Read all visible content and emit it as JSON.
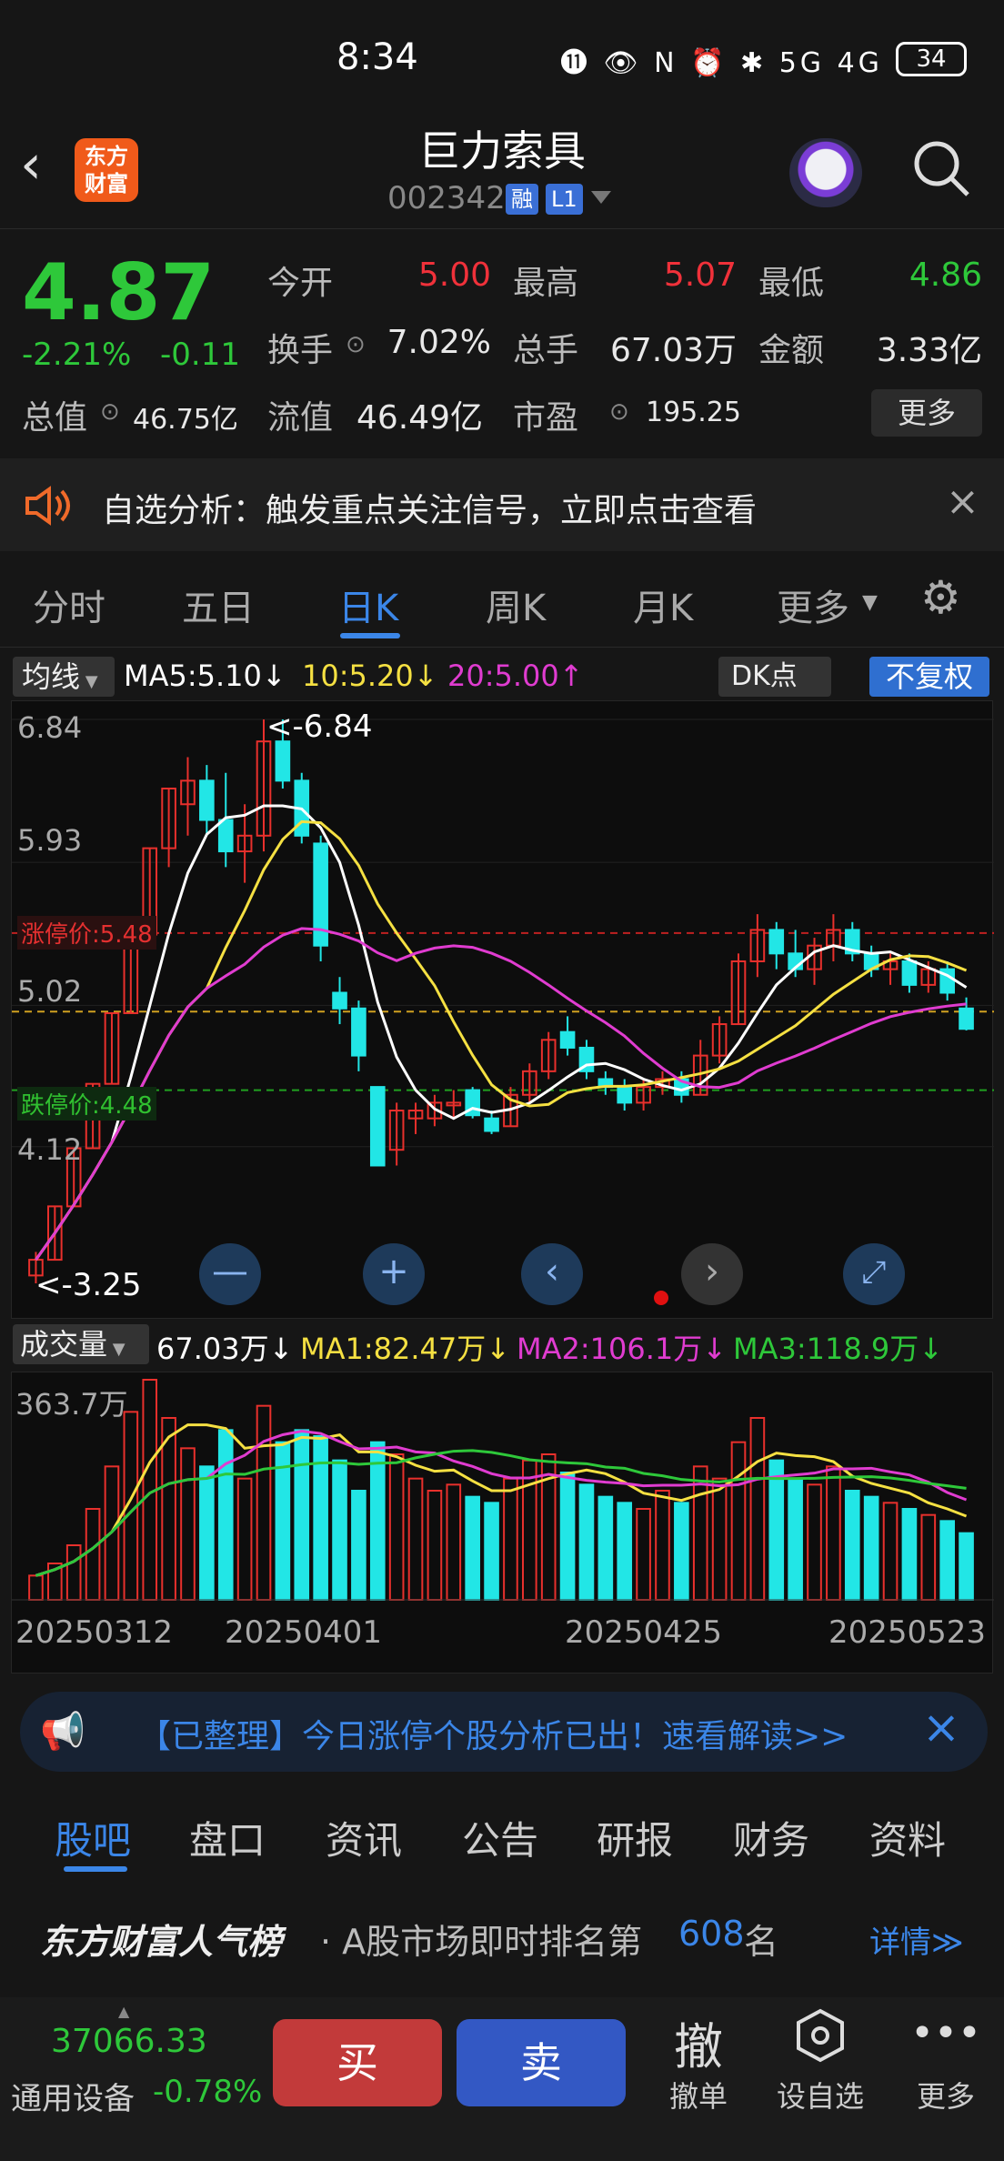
{
  "status": {
    "time": "8:34",
    "battery": "34",
    "icons": "⓫ 👁 N ⏰ ✱ 5G 4G"
  },
  "header": {
    "title": "巨力索具",
    "code": "002342",
    "tags": [
      "融",
      "L1"
    ],
    "logo": "东方\n财富"
  },
  "quote": {
    "price": "4.87",
    "change_pct": "-2.21%",
    "change_amt": "-0.11",
    "rows": [
      [
        {
          "l": "今开",
          "v": "5.00",
          "c": "up"
        },
        {
          "l": "最高",
          "v": "5.07",
          "c": "up"
        },
        {
          "l": "最低",
          "v": "4.86",
          "c": "down"
        }
      ],
      [
        {
          "l": "换手",
          "v": "7.02%",
          "c": ""
        },
        {
          "l": "总手",
          "v": "67.03万",
          "c": ""
        },
        {
          "l": "金额",
          "v": "3.33亿",
          "c": ""
        }
      ],
      [
        {
          "l": "总值",
          "v": "46.75亿",
          "c": ""
        },
        {
          "l": "流值",
          "v": "46.49亿",
          "c": ""
        },
        {
          "l": "市盈",
          "v": "195.25",
          "c": ""
        }
      ]
    ],
    "more": "更多"
  },
  "alert": {
    "text": "自选分析：触发重点关注信号，立即点击查看"
  },
  "tabs": [
    "分时",
    "五日",
    "日K",
    "周K",
    "月K",
    "更多"
  ],
  "active_tab": 2,
  "chart_labels": {
    "ma_selector": "均线",
    "ma5": "MA5:5.10↓",
    "ma10": "10:5.20↓",
    "ma20": "20:5.00↑",
    "dk": "DK点",
    "fq": "不复权",
    "y_top": "6.84",
    "y_2": "5.93",
    "y_3": "5.02",
    "y_4": "4.12",
    "y_bottom": "3.25",
    "high_mark": "<-6.84",
    "low_mark": "<-3.25",
    "limit_up": "涨停价:5.48",
    "limit_down": "跌停价:4.48",
    "vol_selector": "成交量",
    "vol_now": "67.03万↓",
    "vma1": "MA1:82.47万↓",
    "vma2": "MA2:106.1万↓",
    "vma3": "MA3:118.9万↓",
    "vol_top": "363.7万",
    "dates": [
      "20250312",
      "20250401",
      "20250425",
      "20250523"
    ]
  },
  "chart_data": {
    "type": "candlestick",
    "ylim": [
      3.25,
      6.84
    ],
    "candles": [
      [
        3.3,
        3.45,
        3.25,
        3.4
      ],
      [
        3.4,
        3.74,
        3.4,
        3.74
      ],
      [
        3.74,
        4.11,
        3.74,
        4.11
      ],
      [
        4.11,
        4.52,
        4.11,
        4.52
      ],
      [
        4.52,
        4.97,
        4.52,
        4.97
      ],
      [
        4.97,
        5.47,
        4.97,
        5.47
      ],
      [
        5.47,
        6.02,
        5.4,
        6.02
      ],
      [
        6.02,
        6.4,
        5.9,
        6.4
      ],
      [
        6.3,
        6.6,
        6.1,
        6.45
      ],
      [
        6.45,
        6.55,
        6.1,
        6.2
      ],
      [
        6.2,
        6.5,
        5.9,
        6.0
      ],
      [
        6.0,
        6.3,
        5.8,
        6.1
      ],
      [
        6.1,
        6.84,
        6.0,
        6.7
      ],
      [
        6.7,
        6.84,
        6.4,
        6.45
      ],
      [
        6.45,
        6.5,
        6.05,
        6.1
      ],
      [
        6.05,
        6.1,
        5.3,
        5.4
      ],
      [
        5.1,
        5.2,
        4.9,
        5.0
      ],
      [
        5.0,
        5.05,
        4.6,
        4.7
      ],
      [
        4.5,
        4.5,
        4.0,
        4.0
      ],
      [
        4.1,
        4.4,
        4.0,
        4.35
      ],
      [
        4.3,
        4.4,
        4.2,
        4.35
      ],
      [
        4.3,
        4.45,
        4.25,
        4.4
      ],
      [
        4.4,
        4.48,
        4.3,
        4.4
      ],
      [
        4.48,
        4.5,
        4.3,
        4.32
      ],
      [
        4.3,
        4.35,
        4.2,
        4.22
      ],
      [
        4.25,
        4.5,
        4.25,
        4.45
      ],
      [
        4.45,
        4.65,
        4.4,
        4.6
      ],
      [
        4.6,
        4.85,
        4.55,
        4.8
      ],
      [
        4.85,
        4.95,
        4.7,
        4.75
      ],
      [
        4.75,
        4.8,
        4.55,
        4.6
      ],
      [
        4.55,
        4.6,
        4.45,
        4.5
      ],
      [
        4.5,
        4.55,
        4.35,
        4.4
      ],
      [
        4.4,
        4.55,
        4.35,
        4.5
      ],
      [
        4.5,
        4.6,
        4.45,
        4.55
      ],
      [
        4.55,
        4.6,
        4.4,
        4.45
      ],
      [
        4.45,
        4.8,
        4.45,
        4.7
      ],
      [
        4.7,
        4.95,
        4.65,
        4.9
      ],
      [
        4.9,
        5.35,
        4.9,
        5.3
      ],
      [
        5.3,
        5.6,
        5.2,
        5.5
      ],
      [
        5.5,
        5.55,
        5.25,
        5.35
      ],
      [
        5.35,
        5.5,
        5.2,
        5.25
      ],
      [
        5.25,
        5.45,
        5.15,
        5.4
      ],
      [
        5.4,
        5.6,
        5.3,
        5.5
      ],
      [
        5.5,
        5.55,
        5.3,
        5.35
      ],
      [
        5.35,
        5.4,
        5.2,
        5.25
      ],
      [
        5.25,
        5.35,
        5.15,
        5.3
      ],
      [
        5.3,
        5.35,
        5.1,
        5.15
      ],
      [
        5.15,
        5.3,
        5.1,
        5.25
      ],
      [
        5.25,
        5.3,
        5.05,
        5.1
      ],
      [
        5.0,
        5.07,
        4.86,
        4.87
      ]
    ],
    "volume": [
      40,
      60,
      90,
      150,
      220,
      310,
      363,
      300,
      250,
      220,
      280,
      200,
      320,
      260,
      280,
      270,
      230,
      180,
      260,
      240,
      200,
      180,
      190,
      170,
      160,
      200,
      230,
      240,
      210,
      190,
      170,
      160,
      150,
      180,
      160,
      220,
      200,
      260,
      300,
      230,
      200,
      190,
      220,
      180,
      170,
      160,
      150,
      140,
      130,
      110
    ]
  },
  "banner": {
    "text": "【已整理】今日涨停个股分析已出！速看解读>>"
  },
  "bottom_tabs": [
    "股吧",
    "盘口",
    "资讯",
    "公告",
    "研报",
    "财务",
    "资料"
  ],
  "rank": {
    "brand": "东方财富人气榜",
    "text": "· A股市场即时排名第",
    "num": "608",
    "suffix": "名",
    "link": "详情≫"
  },
  "bar": {
    "index_value": "37066.33",
    "index_name": "通用设备",
    "index_chg": "-0.78%",
    "buy": "买",
    "sell": "卖",
    "cancel_icon": "撤",
    "cancel": "撤单",
    "watch": "设自选",
    "more": "更多"
  }
}
